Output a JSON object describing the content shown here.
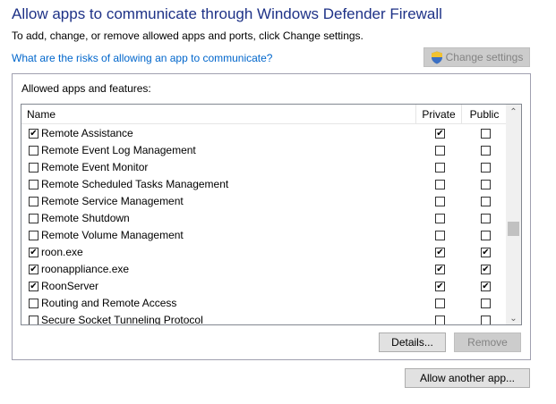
{
  "title": "Allow apps to communicate through Windows Defender Firewall",
  "subtitle": "To add, change, or remove allowed apps and ports, click Change settings.",
  "risk_link": "What are the risks of allowing an app to communicate?",
  "change_settings_label": "Change settings",
  "group_label": "Allowed apps and features:",
  "columns": {
    "name": "Name",
    "private": "Private",
    "public": "Public"
  },
  "rows": [
    {
      "name": "Remote Assistance",
      "enabled": true,
      "private": true,
      "public": false
    },
    {
      "name": "Remote Event Log Management",
      "enabled": false,
      "private": false,
      "public": false
    },
    {
      "name": "Remote Event Monitor",
      "enabled": false,
      "private": false,
      "public": false
    },
    {
      "name": "Remote Scheduled Tasks Management",
      "enabled": false,
      "private": false,
      "public": false
    },
    {
      "name": "Remote Service Management",
      "enabled": false,
      "private": false,
      "public": false
    },
    {
      "name": "Remote Shutdown",
      "enabled": false,
      "private": false,
      "public": false
    },
    {
      "name": "Remote Volume Management",
      "enabled": false,
      "private": false,
      "public": false
    },
    {
      "name": "roon.exe",
      "enabled": true,
      "private": true,
      "public": true
    },
    {
      "name": "roonappliance.exe",
      "enabled": true,
      "private": true,
      "public": true
    },
    {
      "name": "RoonServer",
      "enabled": true,
      "private": true,
      "public": true
    },
    {
      "name": "Routing and Remote Access",
      "enabled": false,
      "private": false,
      "public": false
    },
    {
      "name": "Secure Socket Tunneling Protocol",
      "enabled": false,
      "private": false,
      "public": false
    }
  ],
  "details_label": "Details...",
  "remove_label": "Remove",
  "allow_another_label": "Allow another app...",
  "icons": {
    "shield": "uac-shield-icon",
    "scroll_up": "chevron-up-icon",
    "scroll_down": "chevron-down-icon"
  },
  "colors": {
    "title": "#1e3287",
    "link": "#0066cc"
  }
}
